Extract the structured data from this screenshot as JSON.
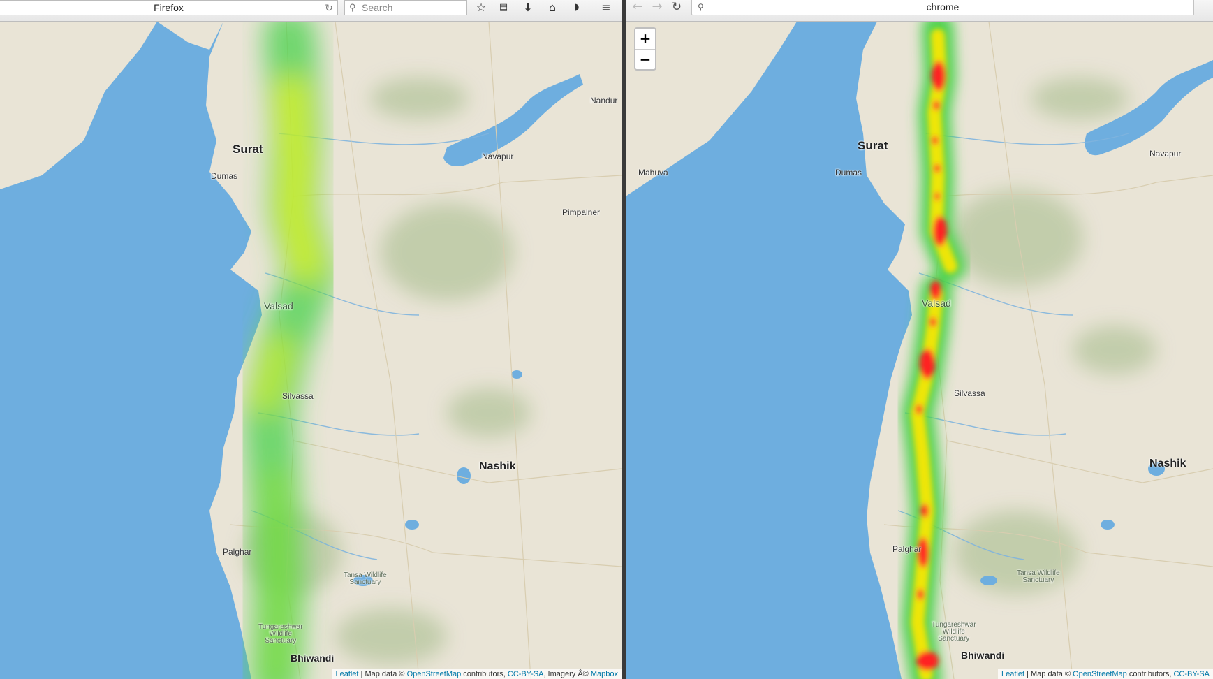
{
  "firefox": {
    "address": "Firefox",
    "search_placeholder": "Search",
    "toolbar_icons": [
      "reload-icon",
      "search-icon",
      "star-icon",
      "reading-list-icon",
      "download-icon",
      "home-icon",
      "pocket-icon",
      "menu-icon"
    ]
  },
  "chrome": {
    "address": "chrome",
    "toolbar_icons": [
      "back-icon",
      "forward-icon",
      "reload-icon",
      "search-icon"
    ]
  },
  "map_left": {
    "places": {
      "surat": "Surat",
      "dumas": "Dumas",
      "navapur": "Navapur",
      "nandur": "Nandur",
      "pimpalner": "Pimpalner",
      "valsad": "Valsad",
      "silvassa": "Silvassa",
      "nashik": "Nashik",
      "palghar": "Palghar",
      "tansa": "Tansa Wildlife\nSanctuary",
      "tungareshwar": "Tungareshwar\nWildlife\nSanctuary",
      "bhiwandi": "Bhiwandi"
    },
    "attribution": {
      "leaflet": "Leaflet",
      "sep1": "| Map data ©",
      "osm": "OpenStreetMap",
      "contrib": "contributors,",
      "license": "CC-BY-SA",
      "imagery": ", Imagery Â©",
      "mapbox": "Mapbox"
    },
    "heatmap_style": "blurred green-yellow"
  },
  "map_right": {
    "zoom_in": "+",
    "zoom_out": "−",
    "places": {
      "surat": "Surat",
      "dumas": "Dumas",
      "mahuva": "Mahuva",
      "navapur": "Navapur",
      "valsad": "Valsad",
      "silvassa": "Silvassa",
      "nashik": "Nashik",
      "palghar": "Palghar",
      "tansa": "Tansa Wildlife\nSanctuary",
      "tungareshwar": "Tungareshwar\nWildlife\nSanctuary",
      "bhiwandi": "Bhiwandi"
    },
    "attribution": {
      "leaflet": "Leaflet",
      "sep1": "| Map data ©",
      "osm": "OpenStreetMap",
      "contrib": "contributors,",
      "license": "CC-BY-SA"
    },
    "heatmap_style": "sharp red-yellow-green"
  },
  "colors": {
    "land": "#e9e4d6",
    "water": "#6eaedf",
    "forest": "#bcc9a4",
    "heat_low": "#46d24a",
    "heat_mid": "#ffe800",
    "heat_high": "#ff2020"
  }
}
